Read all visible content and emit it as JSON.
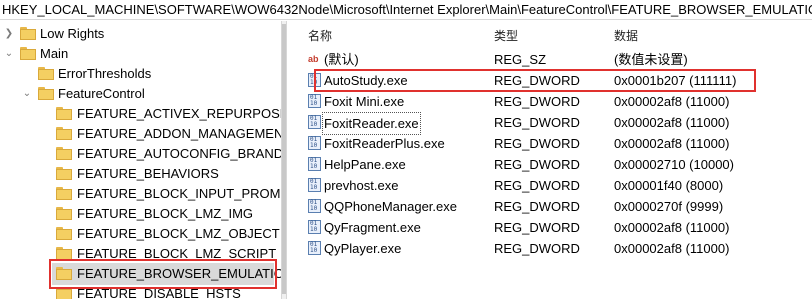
{
  "address_bar": "HKEY_LOCAL_MACHINE\\SOFTWARE\\WOW6432Node\\Microsoft\\Internet Explorer\\Main\\FeatureControl\\FEATURE_BROWSER_EMULATION",
  "tree": {
    "items": [
      {
        "label": "Low Rights",
        "expanded": false
      },
      {
        "label": "Main",
        "expanded": true
      },
      {
        "label": "ErrorThresholds",
        "expanded": false
      },
      {
        "label": "FeatureControl",
        "expanded": true
      },
      {
        "label": "FEATURE_ACTIVEX_REPURPOSEDETECTION",
        "expanded": false
      },
      {
        "label": "FEATURE_ADDON_MANAGEMENT",
        "expanded": false
      },
      {
        "label": "FEATURE_AUTOCONFIG_BRANDING",
        "expanded": false
      },
      {
        "label": "FEATURE_BEHAVIORS",
        "expanded": false
      },
      {
        "label": "FEATURE_BLOCK_INPUT_PROMPTS",
        "expanded": false
      },
      {
        "label": "FEATURE_BLOCK_LMZ_IMG",
        "expanded": false
      },
      {
        "label": "FEATURE_BLOCK_LMZ_OBJECT",
        "expanded": false
      },
      {
        "label": "FEATURE_BLOCK_LMZ_SCRIPT",
        "expanded": false
      },
      {
        "label": "FEATURE_BROWSER_EMULATION",
        "expanded": false,
        "selected": true
      },
      {
        "label": "FEATURE_DISABLE_HSTS",
        "expanded": false
      }
    ]
  },
  "list": {
    "columns": {
      "name": "名称",
      "type": "类型",
      "data": "数据"
    },
    "rows": [
      {
        "icon": "string-value-icon",
        "name": "(默认)",
        "type": "REG_SZ",
        "data": "(数值未设置)"
      },
      {
        "icon": "binary-value-icon",
        "name": "AutoStudy.exe",
        "type": "REG_DWORD",
        "data": "0x0001b207 (111111)",
        "highlighted": true
      },
      {
        "icon": "binary-value-icon",
        "name": "Foxit Mini.exe",
        "type": "REG_DWORD",
        "data": "0x00002af8 (11000)"
      },
      {
        "icon": "binary-value-icon",
        "name": "FoxitReader.exe",
        "type": "REG_DWORD",
        "data": "0x00002af8 (11000)",
        "focused": true
      },
      {
        "icon": "binary-value-icon",
        "name": "FoxitReaderPlus.exe",
        "type": "REG_DWORD",
        "data": "0x00002af8 (11000)"
      },
      {
        "icon": "binary-value-icon",
        "name": "HelpPane.exe",
        "type": "REG_DWORD",
        "data": "0x00002710 (10000)"
      },
      {
        "icon": "binary-value-icon",
        "name": "prevhost.exe",
        "type": "REG_DWORD",
        "data": "0x00001f40 (8000)"
      },
      {
        "icon": "binary-value-icon",
        "name": "QQPhoneManager.exe",
        "type": "REG_DWORD",
        "data": "0x0000270f (9999)"
      },
      {
        "icon": "binary-value-icon",
        "name": "QyFragment.exe",
        "type": "REG_DWORD",
        "data": "0x00002af8 (11000)"
      },
      {
        "icon": "binary-value-icon",
        "name": "QyPlayer.exe",
        "type": "REG_DWORD",
        "data": "0x00002af8 (11000)"
      }
    ]
  },
  "colors": {
    "highlight_box": "#e0312e",
    "folder": "#f4cf62"
  }
}
